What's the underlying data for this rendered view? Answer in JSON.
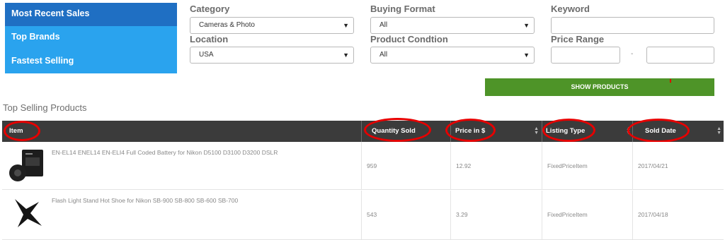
{
  "sidebar": {
    "items": [
      {
        "label": "Most Recent Sales"
      },
      {
        "label": "Top Brands"
      },
      {
        "label": "Fastest Selling"
      }
    ]
  },
  "filters": {
    "category": {
      "label": "Category",
      "value": "Cameras & Photo"
    },
    "buying_format": {
      "label": "Buying Format",
      "value": "All"
    },
    "keyword": {
      "label": "Keyword",
      "value": ""
    },
    "location": {
      "label": "Location",
      "value": "USA"
    },
    "condition": {
      "label": "Product Condtion",
      "value": "All"
    },
    "price_range": {
      "label": "Price Range",
      "min": "",
      "max": "",
      "separator": "-"
    },
    "show_button": "SHOW PRODUCTS"
  },
  "section_title": "Top Selling Products",
  "table": {
    "headers": {
      "item": "Item",
      "quantity": "Quantity Sold",
      "price": "Price in $",
      "listing": "Listing Type",
      "date": "Sold Date"
    },
    "rows": [
      {
        "title": "EN-EL14 ENEL14 EN-ELI4 Full Coded Battery for Nikon D5100 D3100 D3200 DSLR",
        "quantity": "959",
        "price": "12.92",
        "listing": "FixedPriceItem",
        "date": "2017/04/21",
        "icon": "camera-battery-icon"
      },
      {
        "title": "Flash Light Stand Hot Shoe for Nikon SB-900 SB-800 SB-600 SB-700",
        "quantity": "543",
        "price": "3.29",
        "listing": "FixedPriceItem",
        "date": "2017/04/18",
        "icon": "flash-stand-icon"
      }
    ]
  },
  "colors": {
    "sidebar": "#2aa3ee",
    "sidebar_active": "#1f6fc3",
    "button": "#4e9428",
    "table_header": "#3b3b3b",
    "highlight": "#e60000"
  }
}
